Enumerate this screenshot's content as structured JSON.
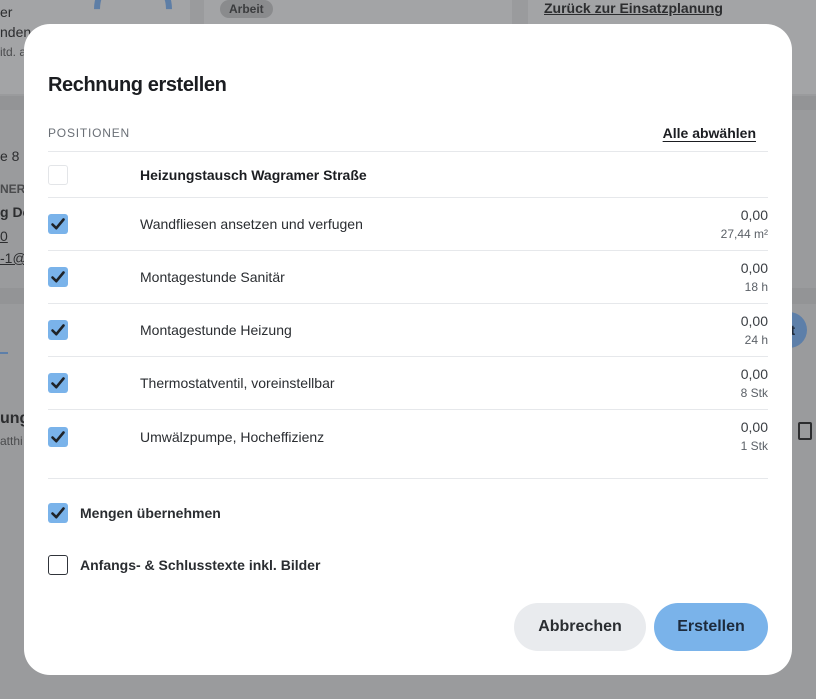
{
  "background": {
    "texts": [
      {
        "id": "bg-t1",
        "text": "er"
      },
      {
        "id": "bg-t2",
        "text": "nden"
      },
      {
        "id": "bg-t3",
        "text": "itd. a"
      },
      {
        "id": "bg-t4",
        "text": "e 8"
      },
      {
        "id": "bg-t5",
        "text": "NER"
      },
      {
        "id": "bg-t6",
        "text": "g Do"
      },
      {
        "id": "bg-t7",
        "text": "0"
      },
      {
        "id": "bg-t8",
        "text": "-1@"
      },
      {
        "id": "bg-t9",
        "text": "ung"
      },
      {
        "id": "bg-t10",
        "text": "atthi"
      }
    ],
    "pill_label": "Arbeit",
    "back_link": "Zurück zur Einsatzplanung",
    "blue_button_fragment": "nt"
  },
  "modal": {
    "title": "Rechnung erstellen",
    "positions_label": "POSITIONEN",
    "deselect_all": "Alle abwählen",
    "group": {
      "name": "Heizungstausch Wagramer Straße",
      "checked": false
    },
    "items": [
      {
        "name": "Wandfliesen ansetzen und verfugen",
        "price": "0,00",
        "qty": "27,44 m²",
        "checked": true
      },
      {
        "name": "Montagestunde Sanitär",
        "price": "0,00",
        "qty": "18 h",
        "checked": true
      },
      {
        "name": "Montagestunde Heizung",
        "price": "0,00",
        "qty": "24 h",
        "checked": true
      },
      {
        "name": "Thermostatventil, voreinstellbar",
        "price": "0,00",
        "qty": "8 Stk",
        "checked": true
      },
      {
        "name": "Umwälzpumpe, Hocheffizienz",
        "price": "0,00",
        "qty": "1 Stk",
        "checked": true
      }
    ],
    "options": {
      "take_quantities": {
        "label": "Mengen übernehmen",
        "checked": true
      },
      "intro_outro_texts": {
        "label": "Anfangs- & Schlusstexte inkl. Bilder",
        "checked": false
      }
    },
    "buttons": {
      "cancel": "Abbrechen",
      "create": "Erstellen"
    }
  },
  "colors": {
    "accent": "#7ab3ea",
    "overlay": "#9a9b9d",
    "divider": "#e6e8eb"
  },
  "icons": {
    "checkmark": "check-icon",
    "document": "document-icon"
  }
}
